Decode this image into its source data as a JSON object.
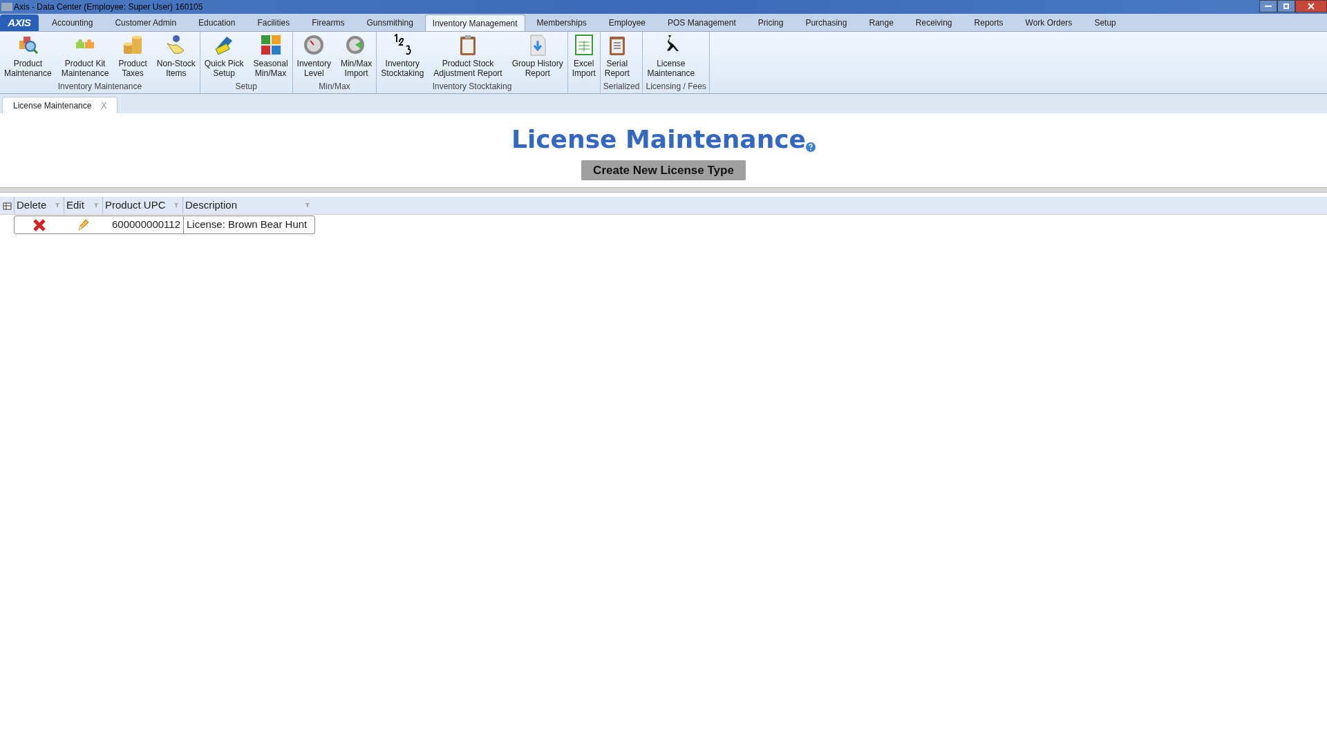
{
  "window": {
    "title": "Axis - Data Center  (Employee: Super User) 160105"
  },
  "menu": {
    "logo": "AXIS",
    "tabs": [
      {
        "label": "Accounting",
        "selected": false
      },
      {
        "label": "Customer Admin",
        "selected": false
      },
      {
        "label": "Education",
        "selected": false
      },
      {
        "label": "Facilities",
        "selected": false
      },
      {
        "label": "Firearms",
        "selected": false
      },
      {
        "label": "Gunsmithing",
        "selected": false
      },
      {
        "label": "Inventory Management",
        "selected": true
      },
      {
        "label": "Memberships",
        "selected": false
      },
      {
        "label": "Employee",
        "selected": false
      },
      {
        "label": "POS Management",
        "selected": false
      },
      {
        "label": "Pricing",
        "selected": false
      },
      {
        "label": "Purchasing",
        "selected": false
      },
      {
        "label": "Range",
        "selected": false
      },
      {
        "label": "Receiving",
        "selected": false
      },
      {
        "label": "Reports",
        "selected": false
      },
      {
        "label": "Work Orders",
        "selected": false
      },
      {
        "label": "Setup",
        "selected": false
      }
    ]
  },
  "ribbon": {
    "groups": [
      {
        "label": "Inventory Maintenance",
        "buttons": [
          {
            "lines": [
              "Product",
              "Maintenance"
            ]
          },
          {
            "lines": [
              "Product Kit",
              "Maintenance"
            ]
          },
          {
            "lines": [
              "Product",
              "Taxes"
            ]
          },
          {
            "lines": [
              "Non-Stock",
              "Items"
            ]
          }
        ]
      },
      {
        "label": "Setup",
        "buttons": [
          {
            "lines": [
              "Quick Pick",
              "Setup"
            ]
          },
          {
            "lines": [
              "Seasonal",
              "Min/Max"
            ]
          }
        ]
      },
      {
        "label": "Min/Max",
        "buttons": [
          {
            "lines": [
              "Inventory",
              "Level"
            ]
          },
          {
            "lines": [
              "Min/Max",
              "Import"
            ]
          }
        ]
      },
      {
        "label": "Inventory Stocktaking",
        "buttons": [
          {
            "lines": [
              "Inventory",
              "Stocktaking"
            ]
          },
          {
            "lines": [
              "Product Stock",
              "Adjustment Report"
            ]
          },
          {
            "lines": [
              "Group History",
              "Report"
            ]
          }
        ]
      },
      {
        "buttons": [
          {
            "lines": [
              "Excel",
              "Import"
            ]
          }
        ]
      },
      {
        "label": "Serialized",
        "buttons": [
          {
            "lines": [
              "Serial",
              "Report"
            ]
          }
        ]
      },
      {
        "label": "Licensing / Fees",
        "buttons": [
          {
            "lines": [
              "License",
              "Maintenance"
            ]
          }
        ]
      }
    ]
  },
  "document_tabs": [
    {
      "label": "License Maintenance",
      "close": "X",
      "selected": true
    }
  ],
  "page": {
    "title": "License Maintenance",
    "action": "Create New License Type"
  },
  "table": {
    "columns": [
      "Delete",
      "Edit",
      "Product UPC",
      "Description"
    ],
    "rows": [
      {
        "product_upc": "600000000112",
        "description": "License: Brown Bear Hunt"
      }
    ]
  }
}
